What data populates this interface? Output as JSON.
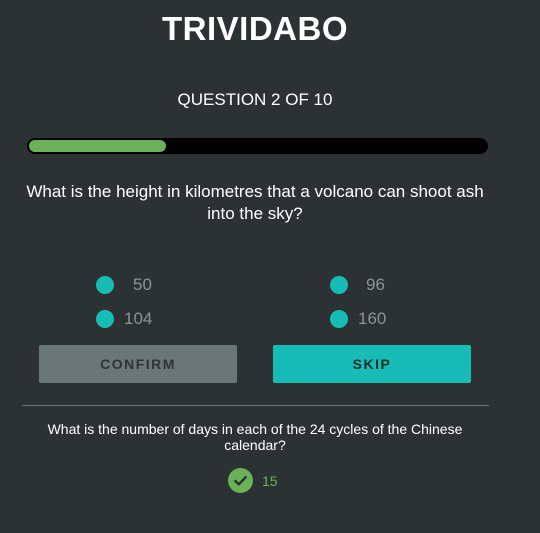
{
  "app": {
    "title": "TRIVIDABO"
  },
  "quiz": {
    "counter": "QUESTION 2 OF 10",
    "progress_fraction": 0.3,
    "question": "What is the height in kilometres that a volcano can shoot ash into the sky?",
    "answers": [
      {
        "label": "50"
      },
      {
        "label": "96"
      },
      {
        "label": "104"
      },
      {
        "label": "160"
      }
    ],
    "confirm_label": "CONFIRM",
    "skip_label": "SKIP"
  },
  "previous": {
    "question": "What is the number of days in each of the 24 cycles of the Chinese calendar?",
    "answer": "15",
    "status_icon": "check-circle-icon"
  },
  "colors": {
    "background": "#2c3233",
    "accent_teal": "#18bcb6",
    "progress_green": "#6ab15a",
    "confirm_disabled": "#6b7677"
  }
}
